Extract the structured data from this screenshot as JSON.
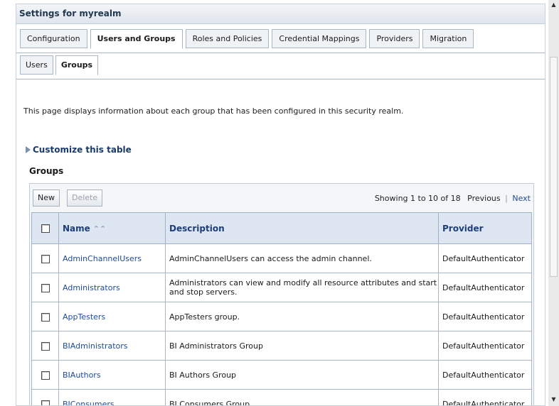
{
  "panel": {
    "title": "Settings for myrealm"
  },
  "tabs_primary": [
    {
      "label": "Configuration",
      "active": false
    },
    {
      "label": "Users and Groups",
      "active": true
    },
    {
      "label": "Roles and Policies",
      "active": false
    },
    {
      "label": "Credential Mappings",
      "active": false
    },
    {
      "label": "Providers",
      "active": false
    },
    {
      "label": "Migration",
      "active": false
    }
  ],
  "tabs_secondary": [
    {
      "label": "Users",
      "active": false
    },
    {
      "label": "Groups",
      "active": true
    }
  ],
  "page_description": "This page displays information about each group that has been configured in this security realm.",
  "customize_label": "Customize this table",
  "groups_heading": "Groups",
  "toolbar": {
    "new_label": "New",
    "delete_label": "Delete",
    "showing_text": "Showing 1 to 10 of 18",
    "previous_label": "Previous",
    "separator": "|",
    "next_label": "Next"
  },
  "table": {
    "columns": [
      "Name",
      "Description",
      "Provider"
    ],
    "sort_icon": "sort-ascending-icon",
    "rows": [
      {
        "name": "AdminChannelUsers",
        "description": "AdminChannelUsers can access the admin channel.",
        "provider": "DefaultAuthenticator"
      },
      {
        "name": "Administrators",
        "description": "Administrators can view and modify all resource attributes and start and stop servers.",
        "provider": "DefaultAuthenticator"
      },
      {
        "name": "AppTesters",
        "description": "AppTesters group.",
        "provider": "DefaultAuthenticator"
      },
      {
        "name": "BIAdministrators",
        "description": "BI Administrators Group",
        "provider": "DefaultAuthenticator"
      },
      {
        "name": "BIAuthors",
        "description": "BI Authors Group",
        "provider": "DefaultAuthenticator"
      },
      {
        "name": "BIConsumers",
        "description": "BI Consumers Group",
        "provider": "DefaultAuthenticator"
      }
    ]
  }
}
